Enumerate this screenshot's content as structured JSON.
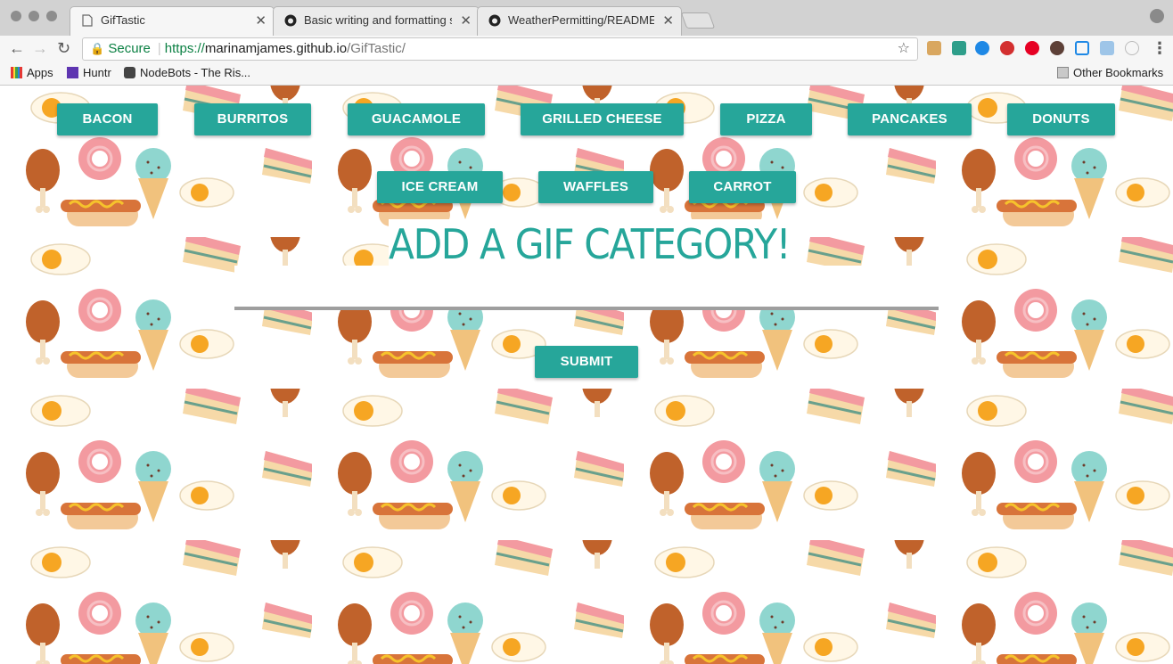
{
  "browser": {
    "tabs": [
      {
        "label": "GifTastic",
        "active": true
      },
      {
        "label": "Basic writing and formatting sy",
        "active": false
      },
      {
        "label": "WeatherPermitting/README.m",
        "active": false
      }
    ],
    "omnibox": {
      "secure_label": "Secure",
      "url_scheme": "https://",
      "url_host": "marinamjames.github.io",
      "url_path": "/GifTastic/"
    },
    "bookmarks": [
      {
        "label": "Apps"
      },
      {
        "label": "Huntr"
      },
      {
        "label": "NodeBots - The Ris..."
      }
    ],
    "other_bookmarks": "Other Bookmarks"
  },
  "page": {
    "categories": [
      "BACON",
      "BURRITOS",
      "GUACAMOLE",
      "GRILLED CHEESE",
      "PIZZA",
      "PANCAKES",
      "DONUTS",
      "ICE CREAM",
      "WAFFLES",
      "CARROT"
    ],
    "form": {
      "title": "ADD A GIF CATEGORY!",
      "input_value": "",
      "submit_label": "SUBMIT"
    },
    "accent_color": "#26a69a"
  }
}
